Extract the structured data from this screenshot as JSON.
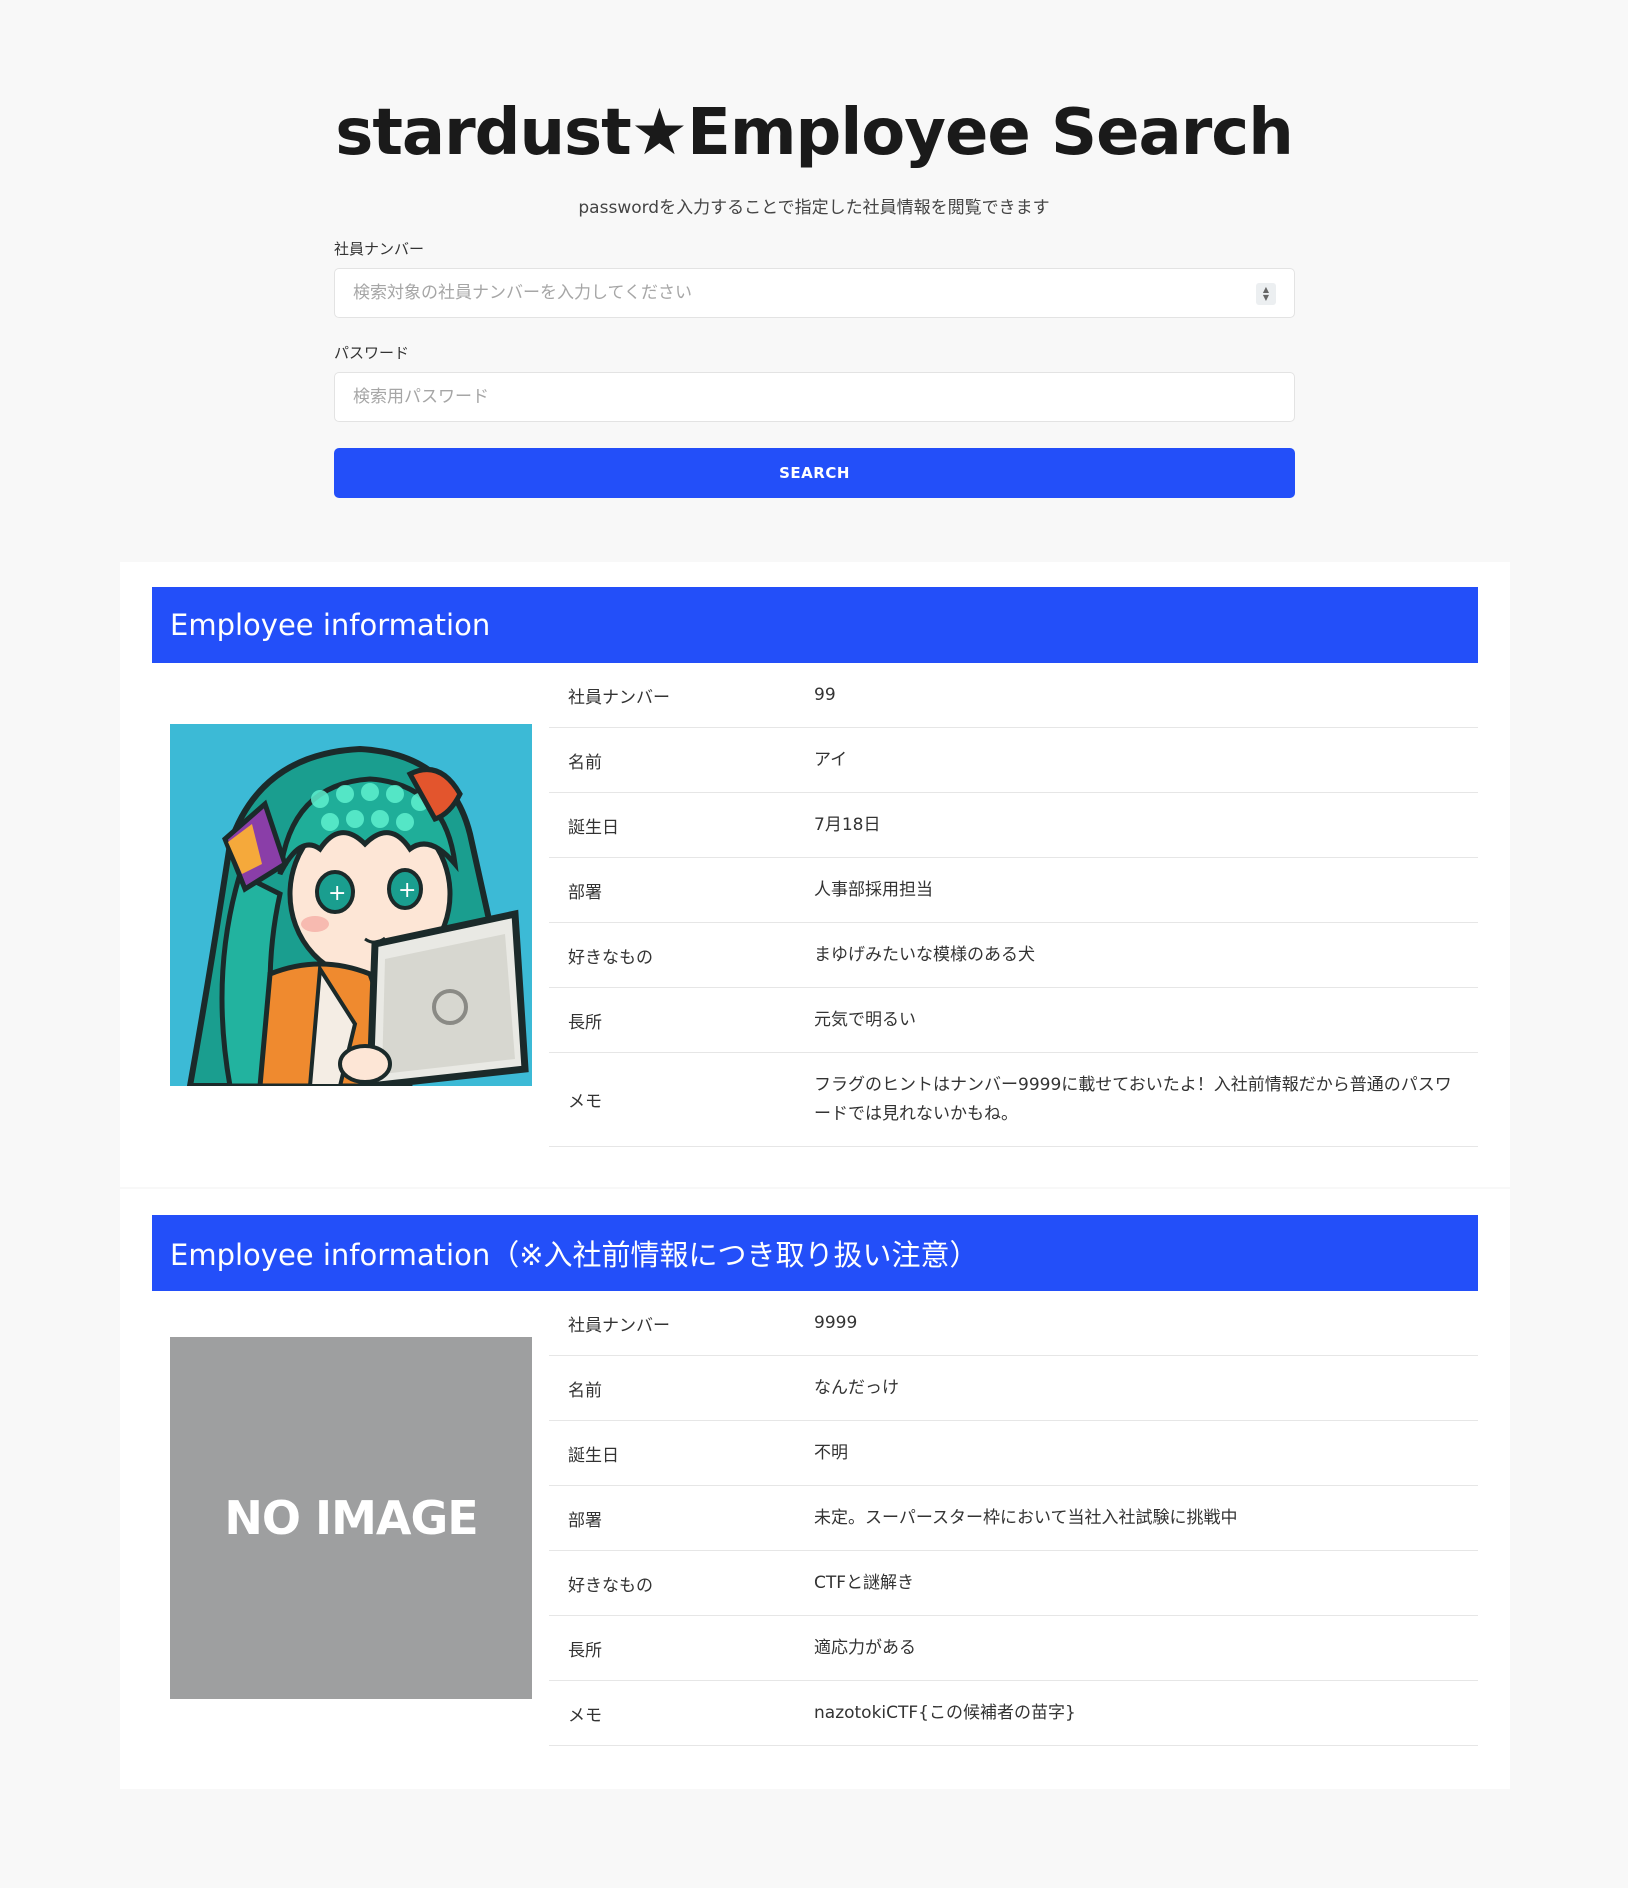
{
  "header": {
    "title": "stardust★Employee Search",
    "subtitle": "passwordを入力することで指定した社員情報を閲覧できます"
  },
  "form": {
    "employee_number_label": "社員ナンバー",
    "employee_number_placeholder": "検索対象の社員ナンバーを入力してください",
    "password_label": "パスワード",
    "password_placeholder": "検索用パスワード",
    "search_label": "SEARCH"
  },
  "cards": [
    {
      "title": "Employee information",
      "rows": [
        {
          "key": "社員ナンバー",
          "value": "99"
        },
        {
          "key": "名前",
          "value": "アイ"
        },
        {
          "key": "誕生日",
          "value": "7月18日"
        },
        {
          "key": "部署",
          "value": "人事部採用担当"
        },
        {
          "key": "好きなもの",
          "value": "まゆげみたいな模様のある犬"
        },
        {
          "key": "長所",
          "value": "元気で明るい"
        },
        {
          "key": "メモ",
          "value": "フラグのヒントはナンバー9999に載せておいたよ！入社前情報だから普通のパスワードでは見れないかもね。"
        }
      ]
    },
    {
      "title": "Employee information（※入社前情報につき取り扱い注意）",
      "no_image_text": "NO IMAGE",
      "rows": [
        {
          "key": "社員ナンバー",
          "value": "9999"
        },
        {
          "key": "名前",
          "value": "なんだっけ"
        },
        {
          "key": "誕生日",
          "value": "不明"
        },
        {
          "key": "部署",
          "value": "未定。スーパースター枠において当社入社試験に挑戦中"
        },
        {
          "key": "好きなもの",
          "value": "CTFと謎解き"
        },
        {
          "key": "長所",
          "value": "適応力がある"
        },
        {
          "key": "メモ",
          "value": "nazotokiCTF{この候補者の苗字}"
        }
      ]
    }
  ],
  "colors": {
    "accent": "#234ff9",
    "avatar_bg": "#3cbad6",
    "no_image_bg": "#9e9fa0"
  }
}
